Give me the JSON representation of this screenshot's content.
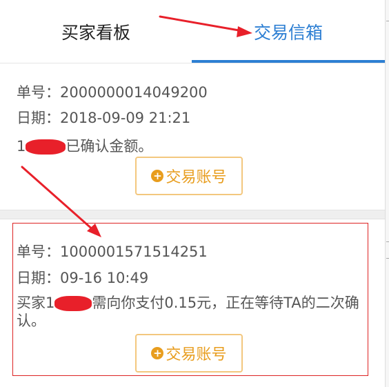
{
  "tabs": {
    "left": "买家看板",
    "right": "交易信箱",
    "active": "right"
  },
  "cards": [
    {
      "order_label": "单号：",
      "order_no": "2000000014049200",
      "date_label": "日期：",
      "date": "2018-09-09 21:21",
      "message_prefix": "1",
      "message_suffix": "已确认金额。",
      "button": "交易账号"
    },
    {
      "order_label": "单号：",
      "order_no": "1000001571514251",
      "date_label": "日期：",
      "date": "09-16 10:49",
      "message_prefix": "买家1",
      "message_suffix": "需向你支付0.15元，正在等待TA的二次确认。",
      "button": "交易账号"
    }
  ],
  "colors": {
    "accent": "#2d7fd3",
    "button_text": "#e89d1e",
    "button_border": "#f3c77e",
    "annotation_red": "#e8202a"
  },
  "icons": {
    "button_icon": "plus-circle-icon"
  }
}
